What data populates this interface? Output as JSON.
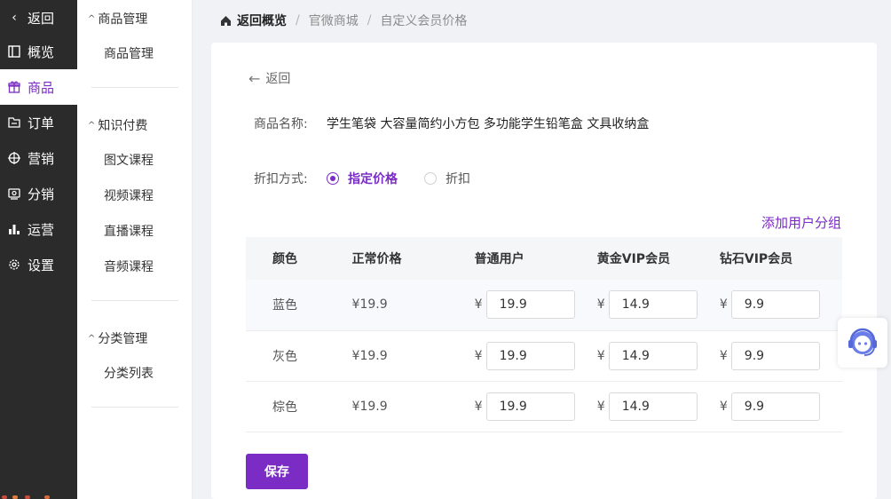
{
  "nav": {
    "back": "返回",
    "items": [
      {
        "label": "概览",
        "icon": "overview-icon"
      },
      {
        "label": "商品",
        "icon": "gift-icon",
        "active": true
      },
      {
        "label": "订单",
        "icon": "order-icon"
      },
      {
        "label": "营销",
        "icon": "target-icon"
      },
      {
        "label": "分销",
        "icon": "distribution-icon"
      },
      {
        "label": "运营",
        "icon": "bar-chart-icon"
      },
      {
        "label": "设置",
        "icon": "gear-icon"
      }
    ]
  },
  "sub": {
    "groups": [
      {
        "title": "商品管理",
        "links": [
          "商品管理"
        ]
      },
      {
        "title": "知识付费",
        "links": [
          "图文课程",
          "视频课程",
          "直播课程",
          "音频课程"
        ]
      },
      {
        "title": "分类管理",
        "links": [
          "分类列表"
        ]
      }
    ]
  },
  "breadcrumb": {
    "home": "返回概览",
    "items": [
      "官微商城",
      "自定义会员价格"
    ]
  },
  "form": {
    "back": "返回",
    "product_label": "商品名称:",
    "product_name": "学生笔袋 大容量简约小方包 多功能学生铅笔盒 文具收纳盒",
    "discount_label": "折扣方式:",
    "discount_options": [
      "指定价格",
      "折扣"
    ],
    "discount_selected": "指定价格",
    "add_group": "添加用户分组",
    "save": "保存"
  },
  "table": {
    "headers": [
      "颜色",
      "正常价格",
      "普通用户",
      "黄金VIP会员",
      "钻石VIP会员"
    ],
    "currency": "¥",
    "rows": [
      {
        "color": "蓝色",
        "price": "¥19.9",
        "normal": "19.9",
        "gold": "14.9",
        "diamond": "9.9"
      },
      {
        "color": "灰色",
        "price": "¥19.9",
        "normal": "19.9",
        "gold": "14.9",
        "diamond": "9.9"
      },
      {
        "color": "棕色",
        "price": "¥19.9",
        "normal": "19.9",
        "gold": "14.9",
        "diamond": "9.9"
      }
    ]
  },
  "colors": {
    "accent": "#7a2cc4",
    "nav_bg": "#2b2b2b",
    "page_bg": "#f0f2f5"
  }
}
